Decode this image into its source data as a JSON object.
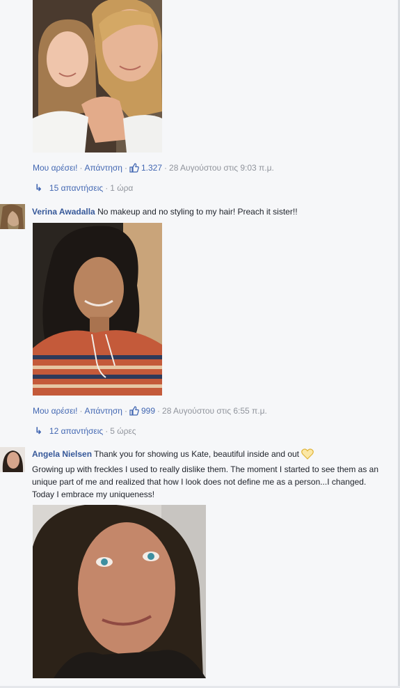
{
  "colors": {
    "link": "#4267b2",
    "author": "#365899",
    "meta": "#90949c",
    "background": "#f6f7f9"
  },
  "comments": [
    {
      "actions": {
        "like": "Μου αρέσει!",
        "reply": "Απάντηση",
        "like_count": "1.327",
        "timestamp": "28 Αυγούστου στις 9:03 π.μ."
      },
      "replies": {
        "count_label": "15 απαντήσεις",
        "time": "1 ώρα"
      }
    },
    {
      "author": "Verina Awadalla",
      "text": "No makeup and no styling to my hair! Preach it sister!!",
      "actions": {
        "like": "Μου αρέσει!",
        "reply": "Απάντηση",
        "like_count": "999",
        "timestamp": "28 Αυγούστου στις 6:55 π.μ."
      },
      "replies": {
        "count_label": "12 απαντήσεις",
        "time": "5 ώρες"
      }
    },
    {
      "author": "Angela Nielsen",
      "text": "Thank you for showing us Kate, beautiful inside and out",
      "text2": "Growing up with freckles I used to really dislike them. The moment I started to see them as an unique part of me and realized that how I look does not define me as a person...I changed. Today I embrace my uniqueness!",
      "emoji": "yellow-heart-icon"
    }
  ],
  "separator": "·"
}
